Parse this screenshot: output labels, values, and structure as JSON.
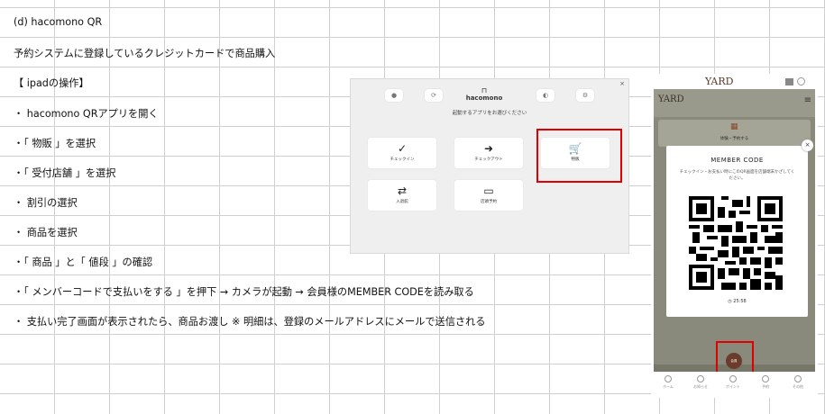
{
  "doc": {
    "lines": [
      "(d)  hacomono QR",
      "予約システムに登録しているクレジットカードで商品購入",
      "【 ipadの操作】",
      "・  hacomono QRアプリを開く",
      "・「 物販 」を選択",
      "・「 受付店舗 」を選択",
      "・  割引の選択",
      "・  商品を選択",
      "・「 商品 」と「 値段 」の確認",
      "・「 メンバーコードで支払いをする 」を押下  →  カメラが起動 →  会員様のMEMBER CODEを読み取る",
      "・  支払い完了画面が表示されたら、商品お渡し  ※ 明細は、登録のメールアドレスにメールで送信される"
    ]
  },
  "ipad": {
    "logo": "hacomono",
    "subtitle": "起動するアプリをお選びください",
    "close": "×",
    "tiles": [
      {
        "icon": "✓",
        "label": "チェックイン"
      },
      {
        "icon": "➜",
        "label": "チェックアウト"
      },
      {
        "icon": "🛒",
        "label": "物販"
      },
      {
        "icon": "⇄",
        "label": "入退館"
      },
      {
        "icon": "▭",
        "label": "店頭予約"
      }
    ]
  },
  "phone": {
    "brand": "YARD",
    "card_label": "体験・予約する",
    "modal": {
      "title": "MEMBER CODE",
      "description": "チェックイン・お支払い時にこのQR画面を店舗端末かざしてください。",
      "timer": "25:58",
      "close": "×"
    },
    "center_button": "会員",
    "tabs": [
      "ホーム",
      "お知らせ",
      "ポイント",
      "予約",
      "その他"
    ]
  }
}
